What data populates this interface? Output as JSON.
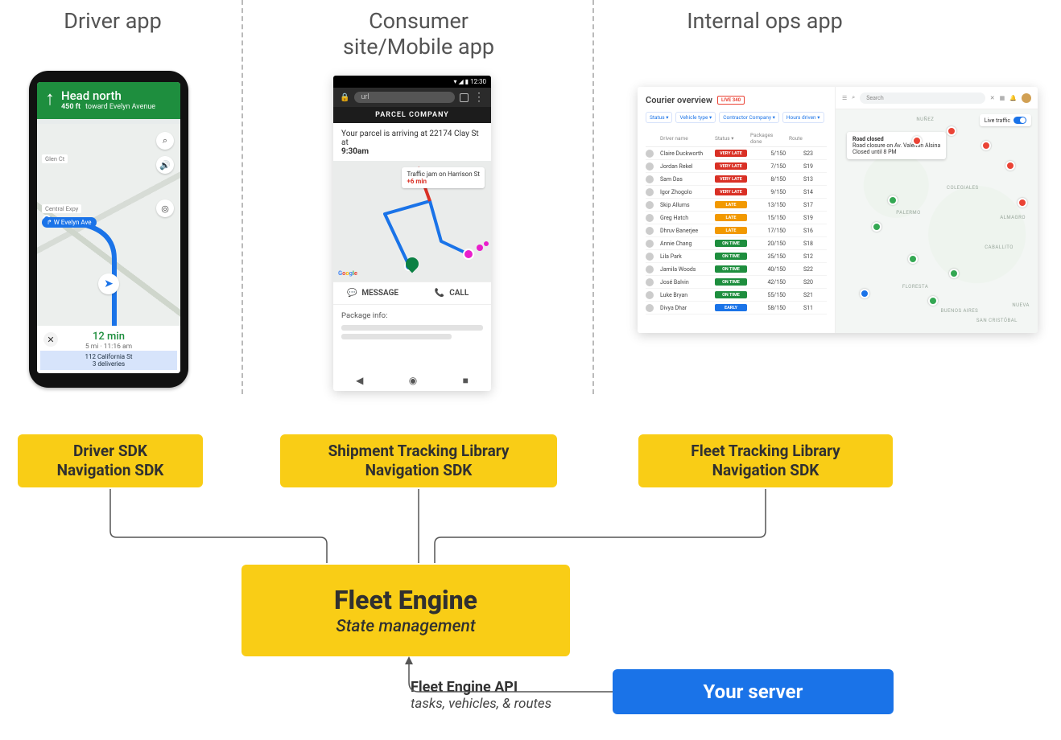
{
  "columns": {
    "driver": "Driver app",
    "consumer": "Consumer\nsite/Mobile app",
    "ops": "Internal ops app"
  },
  "driver_phone": {
    "banner_main": "Head north",
    "banner_dist": "450 ft",
    "banner_sub": "toward Evelyn Avenue",
    "streets": {
      "s1": "Glen Ct",
      "s2": "Central Expy"
    },
    "pill": "↱ W Evelyn Ave",
    "eta": "12 min",
    "eta_sub": "5 mi · 11:16 am",
    "footer_addr": "112 California St",
    "footer_deliv": "3 deliveries"
  },
  "consumer_tile": {
    "status_icons": "▾ ◢ ▮ 12:30",
    "url_text": "url",
    "brand": "PARCEL COMPANY",
    "msg_pre": "Your parcel is arriving at 22174 Clay St at",
    "msg_time": "9:30am",
    "traffic_title": "Traffic jam on Harrison St",
    "traffic_sub": "+6 min",
    "action_msg": "MESSAGE",
    "action_call": "CALL",
    "info_label": "Package info:"
  },
  "ops_tile": {
    "title": "Courier overview",
    "live": "LIVE 340",
    "filters": [
      "Status ▾",
      "Vehicle type ▾",
      "Contractor Company ▾",
      "Hours driven ▾"
    ],
    "columns": [
      "",
      "Driver name",
      "Status ▾",
      "Packages done",
      "Route"
    ],
    "rows": [
      {
        "name": "Claire Duckworth",
        "status": "VERY LATE",
        "cls": "veryl",
        "pkg": "5/150",
        "route": "S23"
      },
      {
        "name": "Jordan Rekel",
        "status": "VERY LATE",
        "cls": "veryl",
        "pkg": "7/150",
        "route": "S19"
      },
      {
        "name": "Sam Das",
        "status": "VERY LATE",
        "cls": "veryl",
        "pkg": "8/150",
        "route": "S13"
      },
      {
        "name": "Igor Zhogolo",
        "status": "VERY LATE",
        "cls": "veryl",
        "pkg": "9/150",
        "route": "S14"
      },
      {
        "name": "Skip Allums",
        "status": "LATE",
        "cls": "late",
        "pkg": "13/150",
        "route": "S17"
      },
      {
        "name": "Greg Hatch",
        "status": "LATE",
        "cls": "late",
        "pkg": "15/150",
        "route": "S19"
      },
      {
        "name": "Dhruv Banerjee",
        "status": "LATE",
        "cls": "late",
        "pkg": "17/150",
        "route": "S16"
      },
      {
        "name": "Annie Chang",
        "status": "ON TIME",
        "cls": "ontime",
        "pkg": "20/150",
        "route": "S18"
      },
      {
        "name": "Lila Park",
        "status": "ON TIME",
        "cls": "ontime",
        "pkg": "35/150",
        "route": "S12"
      },
      {
        "name": "Jamila Woods",
        "status": "ON TIME",
        "cls": "ontime",
        "pkg": "40/150",
        "route": "S22"
      },
      {
        "name": "José Balvin",
        "status": "ON TIME",
        "cls": "ontime",
        "pkg": "42/150",
        "route": "S20"
      },
      {
        "name": "Luke Bryan",
        "status": "ON TIME",
        "cls": "ontime",
        "pkg": "55/150",
        "route": "S21"
      },
      {
        "name": "Divya Dhar",
        "status": "EARLY",
        "cls": "early",
        "pkg": "58/150",
        "route": "S11"
      }
    ],
    "search_ph": "Search",
    "live_traffic": "Live traffic",
    "popup_title": "Road closed",
    "popup_l1": "Road closure on Av. Valentín Alsina",
    "popup_l2": "Closed until 8 PM",
    "areas": [
      "NUÑEZ",
      "COLEGIALES",
      "PALERMO",
      "ALMAGRO",
      "CABALLITO",
      "FLORESTA",
      "NUEVA",
      "BUENOS AIRES",
      "SAN CRISTÓBAL"
    ]
  },
  "sdk_boxes": {
    "driver_l1": "Driver SDK",
    "driver_l2": "Navigation SDK",
    "consumer_l1": "Shipment Tracking Library",
    "consumer_l2": "Navigation SDK",
    "ops_l1": "Fleet Tracking Library",
    "ops_l2": "Navigation SDK"
  },
  "fleet_engine": {
    "title": "Fleet Engine",
    "subtitle": "State management"
  },
  "server_box": "Your server",
  "api_label": {
    "l1": "Fleet Engine API",
    "l2": "tasks, vehicles, & routes"
  }
}
